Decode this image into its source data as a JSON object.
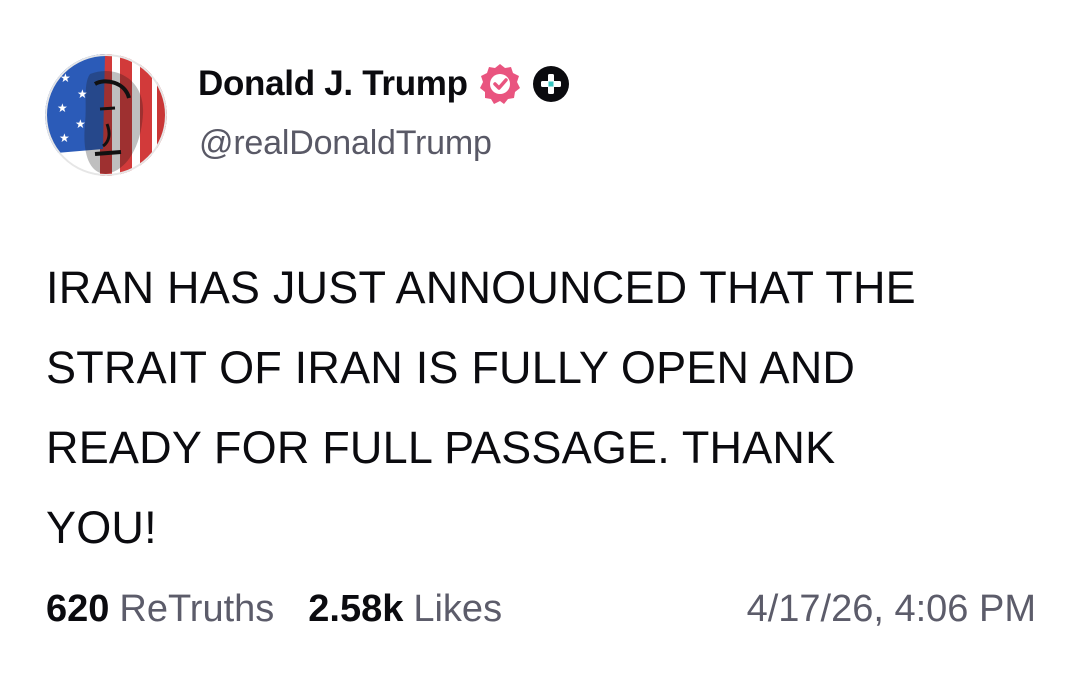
{
  "author": {
    "display_name": "Donald J. Trump",
    "handle": "@realDonaldTrump",
    "verified_color": "#e9547f"
  },
  "post": {
    "text": "IRAN HAS JUST ANNOUNCED THAT THE\nSTRAIT OF IRAN IS FULLY OPEN AND\nREADY FOR FULL PASSAGE. THANK\nYOU!"
  },
  "stats": {
    "retruths_count": "620",
    "retruths_label": "ReTruths",
    "likes_count": "2.58k",
    "likes_label": "Likes",
    "timestamp": "4/17/26, 4:06 PM"
  },
  "icons": {
    "verified": "verified-badge-icon",
    "plus": "plus-badge-icon"
  }
}
